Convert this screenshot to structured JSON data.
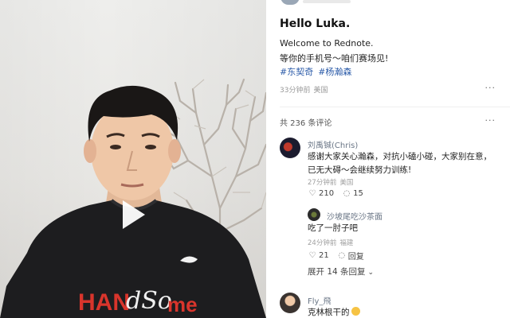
{
  "post": {
    "title": "Hello Luka.",
    "line1": "Welcome to Rednote.",
    "line2": "等你的手机号～咱们赛场见!",
    "tags": [
      "#东契奇",
      "#杨瀚森"
    ],
    "time": "33分钟前",
    "location": "美国",
    "more_icon": "···"
  },
  "comments": {
    "count_label": "共 236 条评论",
    "items": [
      {
        "name": "刘禹铖(Chris)",
        "text": "感谢大家关心瀚森，对抗小磕小碰，大家别在意，已无大碍～会继续努力训练!",
        "time": "27分钟前",
        "location": "美国",
        "likes": "210",
        "replies": "15",
        "more_icon": "···"
      }
    ],
    "reply": {
      "name": "沙坡尾吃沙茶面",
      "text": "吃了一肘子吧",
      "time": "24分钟前",
      "location": "福建",
      "likes": "21",
      "reply_label": "回复"
    },
    "expand_label": "展开 14 条回复",
    "third": {
      "name": "Fly_飛",
      "text": "克林根干的"
    }
  },
  "video": {
    "shirt_text": "HAN",
    "shirt_script": "dSo",
    "shirt_tail": "me"
  },
  "colors": {
    "tag_blue": "#2a5aa8",
    "meta_gray": "#9a9a9a"
  }
}
